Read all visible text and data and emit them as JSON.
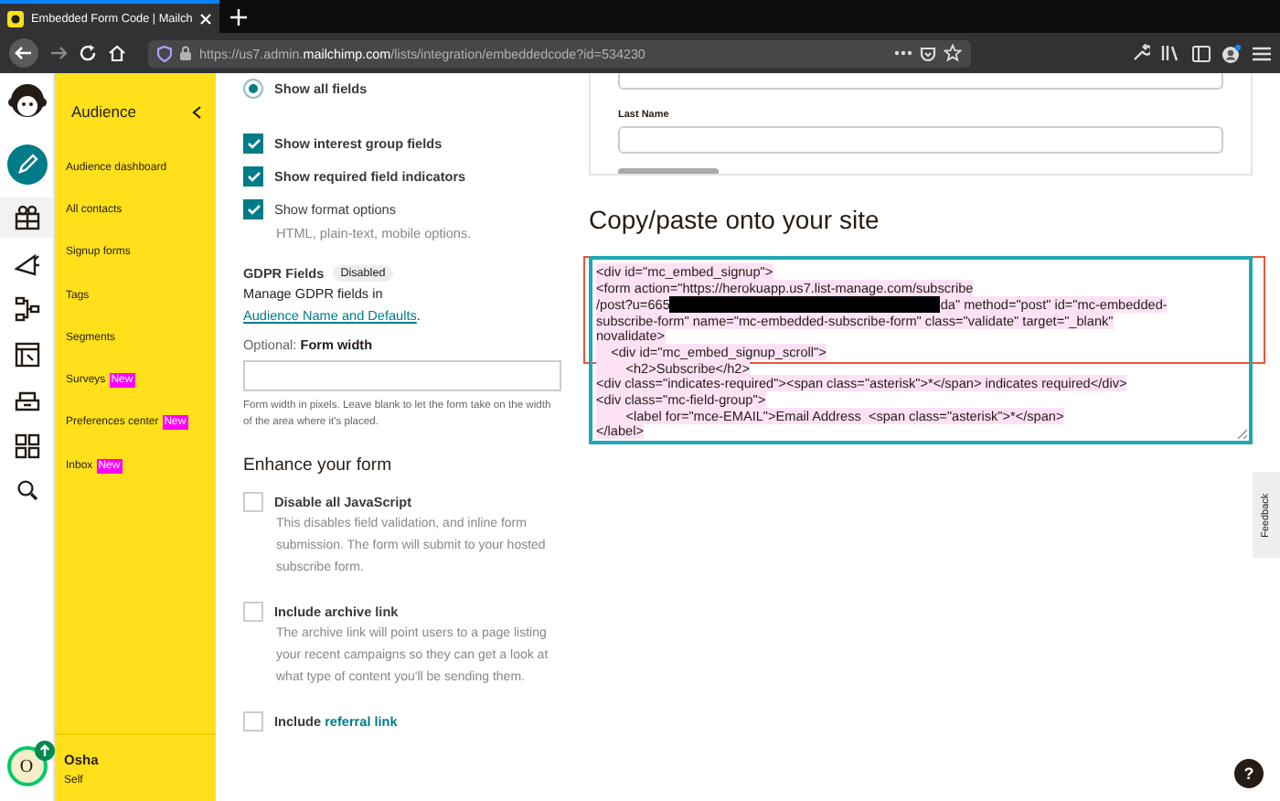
{
  "browser": {
    "tab_title": "Embedded Form Code | Mailch",
    "url_prefix": "https://us7.admin.",
    "url_domain": "mailchimp.com",
    "url_path": "/lists/integration/embeddedcode?id=534230"
  },
  "sidebar": {
    "title": "Audience",
    "items": [
      {
        "label": "Audience dashboard"
      },
      {
        "label": "All contacts"
      },
      {
        "label": "Signup forms"
      },
      {
        "label": "Tags"
      },
      {
        "label": "Segments"
      },
      {
        "label": "Surveys",
        "badge": "New"
      },
      {
        "label": "Preferences center",
        "badge": "New"
      },
      {
        "label": "Inbox",
        "badge": "New"
      }
    ]
  },
  "user": {
    "initial": "O",
    "name": "Osha",
    "role": "Self"
  },
  "form_options": {
    "show_all": {
      "label": "Show all fields",
      "selected": true
    },
    "checkboxes": [
      {
        "label": "Show interest group fields",
        "checked": true
      },
      {
        "label": "Show required field indicators",
        "checked": true
      },
      {
        "label": "Show format options",
        "checked": true,
        "note": "HTML, plain-text, mobile options."
      }
    ],
    "gdpr": {
      "title": "GDPR Fields",
      "badge": "Disabled",
      "text": "Manage GDPR fields in",
      "link": "Audience Name and Defaults",
      "after": "."
    },
    "form_width": {
      "label": "Optional: **Form width**",
      "hint": "Form width in pixels. Leave blank to let the form take on the width of the area where it's placed."
    }
  },
  "enhance": {
    "title": "Enhance your form",
    "options": [
      {
        "label": "Disable all JavaScript",
        "checked": false,
        "description": "This disables field validation, and inline form submission. The form will submit to your hosted subscribe form."
      },
      {
        "label": "Include archive link",
        "checked": false,
        "description": "The archive link will point users to a page listing your recent campaigns so they can get a look at what type of content you'll be sending them."
      },
      {
        "label": "Include",
        "link": "referral link",
        "checked": false
      }
    ]
  },
  "preview": {
    "field_label": "Last Name"
  },
  "copy": {
    "title": "Copy/paste onto your site",
    "code_lines": [
      {
        "kind": "text",
        "text": "<div id=\"mc_embed_signup\">"
      },
      {
        "kind": "text",
        "text": "<form action=\"https://herokuapp.us7.list-manage.com/subscribe"
      },
      {
        "kind": "redacted",
        "before": "/post?u=665",
        "after": "da\" method=\"post\" id=\"mc-embedded-"
      },
      {
        "kind": "text",
        "text": "subscribe-form\" name=\"mc-embedded-subscribe-form\" class=\"validate\" target=\"_blank\""
      },
      {
        "kind": "text",
        "text": "novalidate>"
      },
      {
        "kind": "text",
        "text": "    <div id=\"mc_embed_signup_scroll\">"
      },
      {
        "kind": "text",
        "text": "        <h2>Subscribe</h2>"
      },
      {
        "kind": "text",
        "text": "<div class=\"indicates-required\"><span class=\"asterisk\">*</span> indicates required</div>"
      },
      {
        "kind": "text",
        "text": "<div class=\"mc-field-group\">"
      },
      {
        "kind": "text",
        "text": "        <label for=\"mce-EMAIL\">Email Address  <span class=\"asterisk\">*</span>"
      },
      {
        "kind": "text",
        "text": "</label>"
      }
    ]
  },
  "feedback": "Feedback",
  "help": "?"
}
